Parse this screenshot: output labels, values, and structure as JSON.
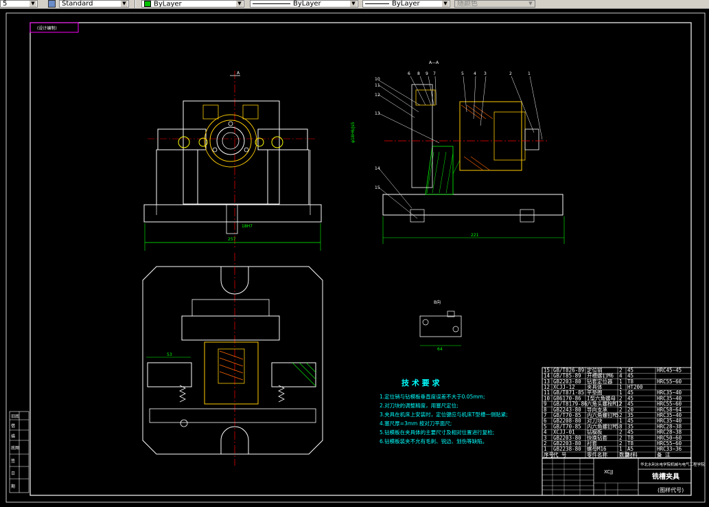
{
  "toolbar": {
    "first_value": "5",
    "textstyle_value": "Standard",
    "layer_color_value": "ByLayer",
    "linetype_value": "ByLayer",
    "lineweight_value": "ByLayer",
    "plotstyle_value": "随颜色"
  },
  "drawing": {
    "corner_tag": "(设计编制)",
    "section_label": "A—A",
    "section_arrow_a": "A",
    "section_arrow_b": "A",
    "view_b_label": "B向",
    "dim_width_front": "257",
    "dim_width_section": "221",
    "dim_phi": "φ18H6/js5",
    "dim_bottom": "53",
    "dim_small": "64",
    "dim_h": "18H7",
    "callouts_top": [
      "6",
      "8",
      "9",
      "7",
      "5",
      "4",
      "3",
      "2",
      "1"
    ],
    "callouts_left": [
      "10",
      "11",
      "12",
      "13",
      "14",
      "15"
    ]
  },
  "tech_req": {
    "title": "技 术 要 求",
    "lines": [
      "1.定位销与钻模板垂直度误差不大于0.05mm;",
      "2.对刀块的调整精度，用塞尺定位;",
      "3.夹具在机床上安装时，定位键应与机床T型槽一侧贴紧;",
      "4.塞尺厚=3mm 按对刀平面尺;",
      "5.钻模板在夹具体的主要尺寸及相对位置进行复检;",
      "6.钻模板装夹不允有毛刺、锐边、划伤等缺陷。"
    ]
  },
  "bom": {
    "rows": [
      {
        "no": "15",
        "code": "GB/T826-89",
        "name": "定位销",
        "qty": "2",
        "mat": "45",
        "note": "HRC45~45"
      },
      {
        "no": "14",
        "code": "GB/T85-89",
        "name": "开槽螺钉M6",
        "qty": "4",
        "mat": "45",
        "note": ""
      },
      {
        "no": "13",
        "code": "GB2203-80",
        "name": "钻套定位器",
        "qty": "1",
        "mat": "T8",
        "note": "HRC55~60"
      },
      {
        "no": "12",
        "code": "XCJJ-12",
        "name": "夹具体",
        "qty": "1",
        "mat": "HT200",
        "note": ""
      },
      {
        "no": "11",
        "code": "GB/T871-85",
        "name": "平垫圈",
        "qty": "1",
        "mat": "45",
        "note": "HRC35~40"
      },
      {
        "no": "10",
        "code": "GB6170-86",
        "name": "I型六角螺母",
        "qty": "2",
        "mat": "45",
        "note": "HRC35~40"
      },
      {
        "no": "9",
        "code": "GB/T8179-86",
        "name": "六角头螺栓M12",
        "qty": "2",
        "mat": "45",
        "note": "HRC55~60"
      },
      {
        "no": "8",
        "code": "GB2243-80",
        "name": "导向支承",
        "qty": "2",
        "mat": "20",
        "note": "HRC58~64"
      },
      {
        "no": "7",
        "code": "GB/T70-85",
        "name": "内六角螺钉M5",
        "qty": "2",
        "mat": "35",
        "note": "HRC35~40"
      },
      {
        "no": "6",
        "code": "GB2208-80",
        "name": "对刀块",
        "qty": "1",
        "mat": "45",
        "note": "HRC35~40"
      },
      {
        "no": "5",
        "code": "GB/T70-85",
        "name": "内六角螺钉M5",
        "qty": "8",
        "mat": "35",
        "note": "HRC28~38"
      },
      {
        "no": "4",
        "code": "XCJJ-01",
        "name": "钻模板",
        "qty": "2",
        "mat": "45",
        "note": "HRC28~38"
      },
      {
        "no": "3",
        "code": "GB2203-80",
        "name": "快换钻套",
        "qty": "2",
        "mat": "T8",
        "note": "HRC50~60"
      },
      {
        "no": "2",
        "code": "GB2203-80",
        "name": "衬套",
        "qty": "2",
        "mat": "T8",
        "note": "HRC55~60"
      },
      {
        "no": "1",
        "code": "GB2238-80",
        "name": "螺母M16",
        "qty": "1",
        "mat": "A5",
        "note": "HRC33~36"
      }
    ],
    "header": {
      "no": "序号",
      "code": "代 号",
      "name": "零件名称",
      "qty": "数量",
      "mat": "材料",
      "note": "备 注"
    }
  },
  "titleblock": {
    "school": "华北水利水电学院机械与电气工程学院",
    "drawing_name": "铣槽夹具",
    "drawing_code": "(图样代号)",
    "scale_tag": "XCJJ"
  },
  "sidebar_marks": [
    "旧底",
    "借",
    "描",
    "底图",
    "签",
    "日",
    "期"
  ]
}
